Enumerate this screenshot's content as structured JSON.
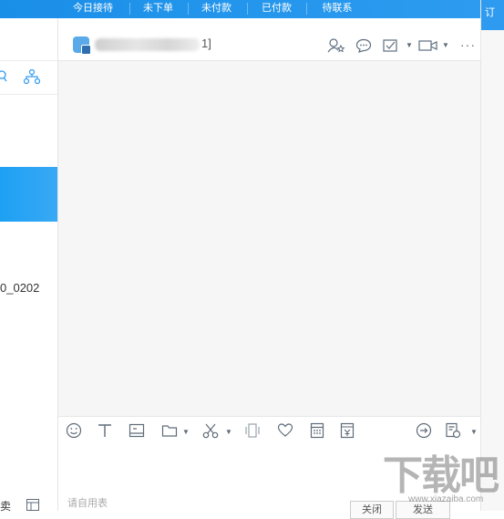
{
  "top_tabs": [
    "今日接待",
    "未下单",
    "未付款",
    "已付款",
    "待联系"
  ],
  "right_strip": {
    "label": "订"
  },
  "left_panel": {
    "contact_label": "0_0202",
    "bottom_label": "卖"
  },
  "chat_header": {
    "contact_name_tail": "1]"
  },
  "composer": {
    "placeholder": "请自用表",
    "close_button": "关闭",
    "send_button": "发送"
  },
  "watermark": {
    "logo_text": "下载吧",
    "url_text": "www.xiazaiba.com"
  },
  "colors": {
    "accent": "#1a8fe8",
    "message_area": "#f6f6f6"
  }
}
